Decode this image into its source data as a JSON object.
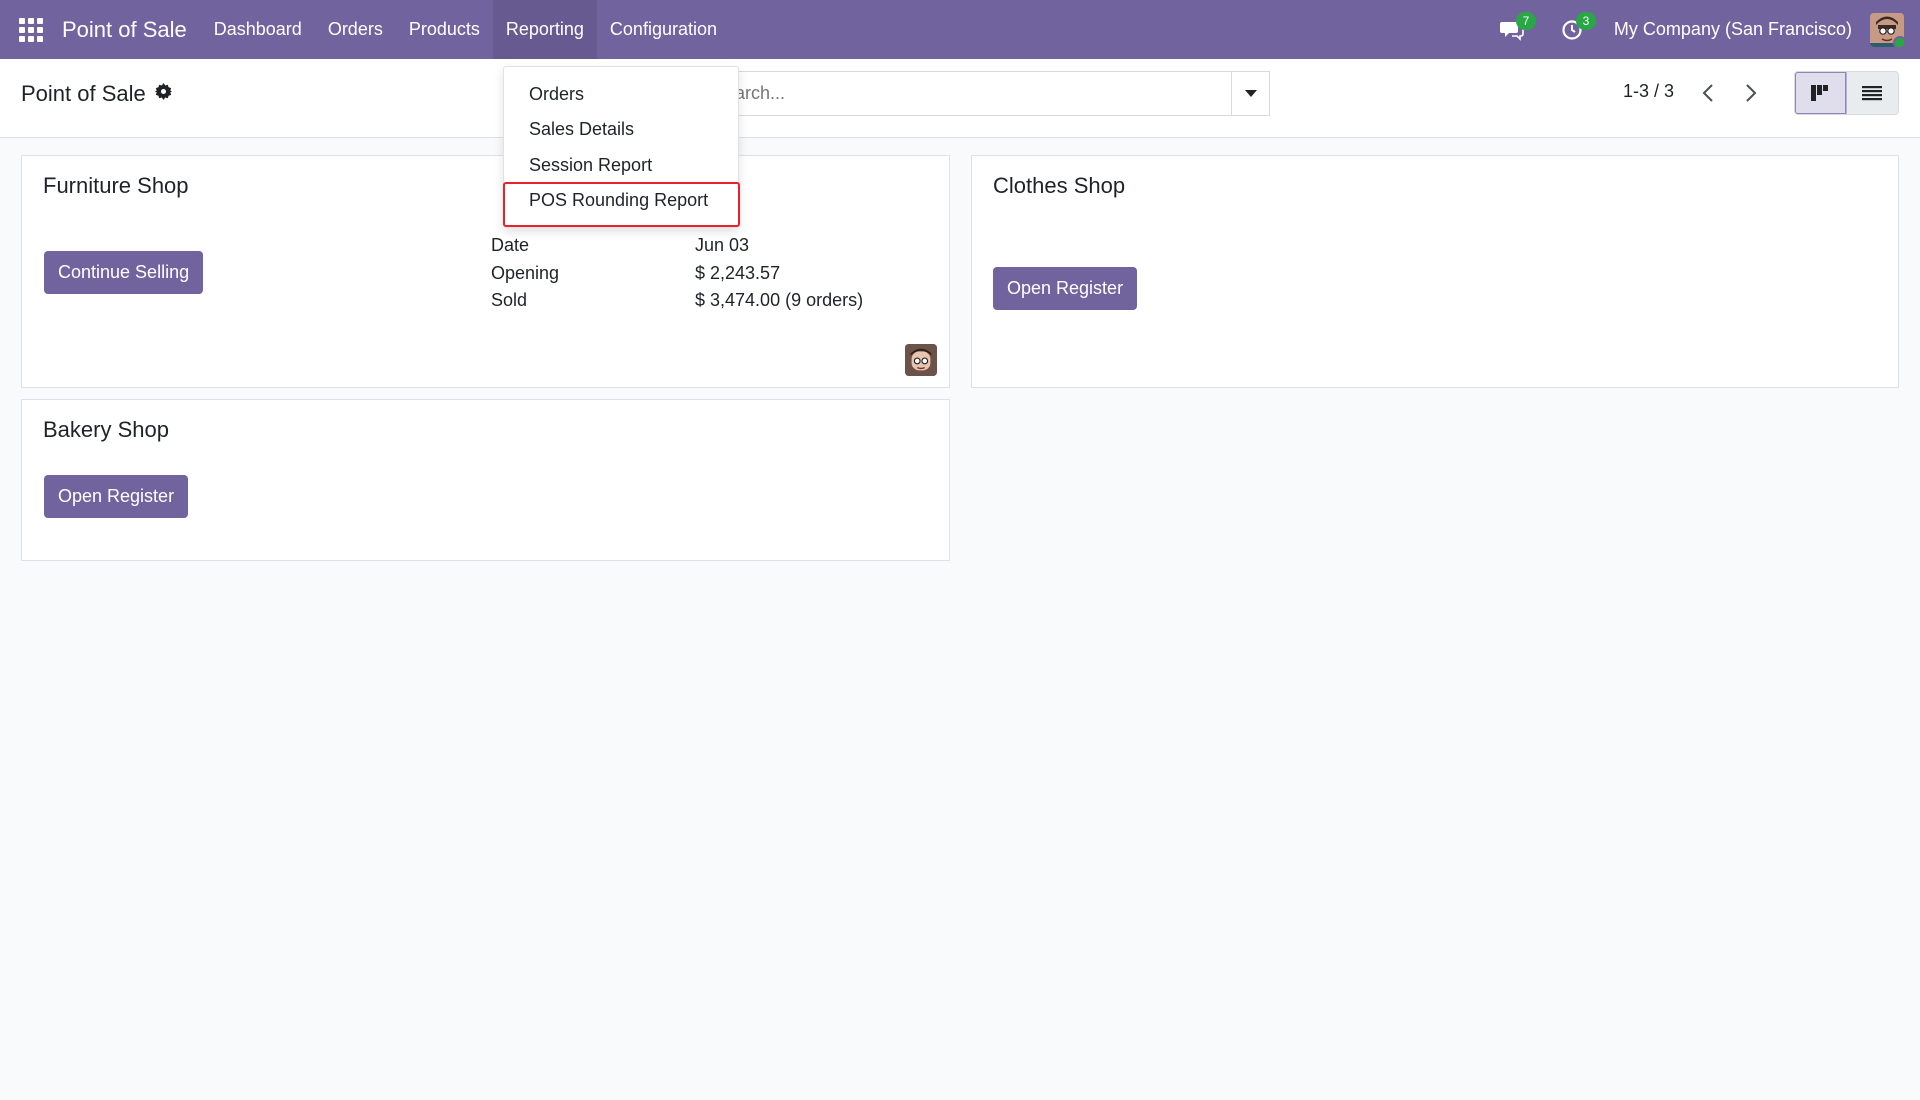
{
  "navbar": {
    "brand": "Point of Sale",
    "menu": [
      "Dashboard",
      "Orders",
      "Products",
      "Reporting",
      "Configuration"
    ],
    "messages_count": "7",
    "activities_count": "3",
    "company": "My Company (San Francisco)"
  },
  "control_panel": {
    "title": "Point of Sale",
    "search_placeholder": "Search...",
    "pager": "1-3 / 3"
  },
  "reporting_menu": {
    "items": [
      "Orders",
      "Sales Details",
      "Session Report",
      "POS Rounding Report"
    ],
    "highlighted": "POS Rounding Report",
    "highlight_color": "#e8212b"
  },
  "cards": [
    {
      "title": "Furniture Shop",
      "button": "Continue Selling",
      "stats": [
        {
          "label": "Date",
          "value": "Jun 03"
        },
        {
          "label": "Opening",
          "value": "$ 2,243.57"
        },
        {
          "label": "Sold",
          "value": "$ 3,474.00 (9 orders)"
        }
      ]
    },
    {
      "title": "Clothes Shop",
      "button": "Open Register"
    },
    {
      "title": "Bakery Shop",
      "button": "Open Register"
    }
  ],
  "colors": {
    "brand": "#71639e",
    "background": "#f9fafb",
    "badge": "#28a745"
  }
}
